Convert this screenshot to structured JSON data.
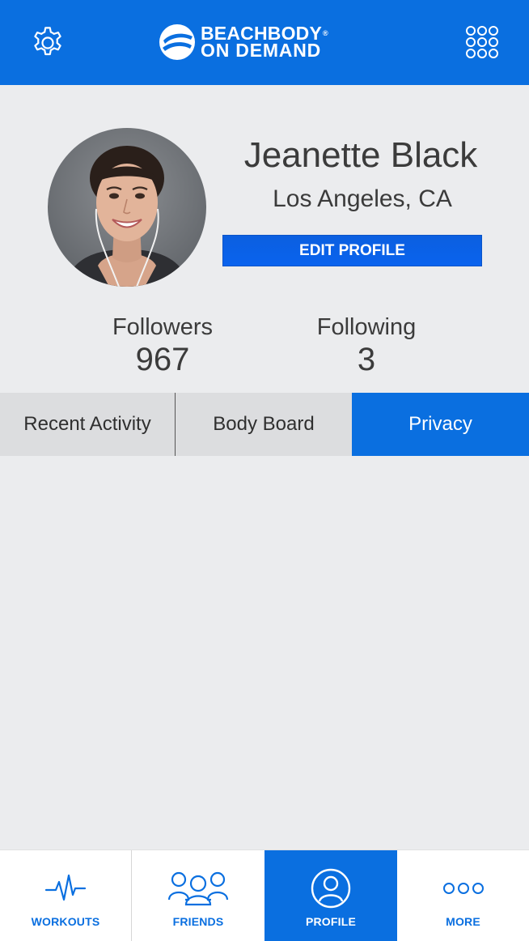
{
  "header": {
    "logo_line1": "BEACHBODY",
    "logo_line2": "ON DEMAND",
    "logo_reg": "®",
    "settings_icon": "gear-icon",
    "apps_icon": "grid-dots-icon"
  },
  "profile": {
    "name": "Jeanette Black",
    "location": "Los Angeles, CA",
    "edit_label": "EDIT PROFILE",
    "followers_label": "Followers",
    "followers_value": "967",
    "following_label": "Following",
    "following_value": "3"
  },
  "tabs": [
    {
      "label": "Recent Activity"
    },
    {
      "label": "Body Board"
    },
    {
      "label": "Privacy",
      "active": true
    }
  ],
  "nav": [
    {
      "label": "WORKOUTS",
      "icon": "heartbeat-icon"
    },
    {
      "label": "FRIENDS",
      "icon": "friends-icon"
    },
    {
      "label": "PROFILE",
      "icon": "profile-icon",
      "active": true
    },
    {
      "label": "MORE",
      "icon": "more-dots-icon"
    }
  ],
  "colors": {
    "brand_blue": "#0a6fe0",
    "background": "#ebecee",
    "tab_inactive": "#dcdddf"
  }
}
